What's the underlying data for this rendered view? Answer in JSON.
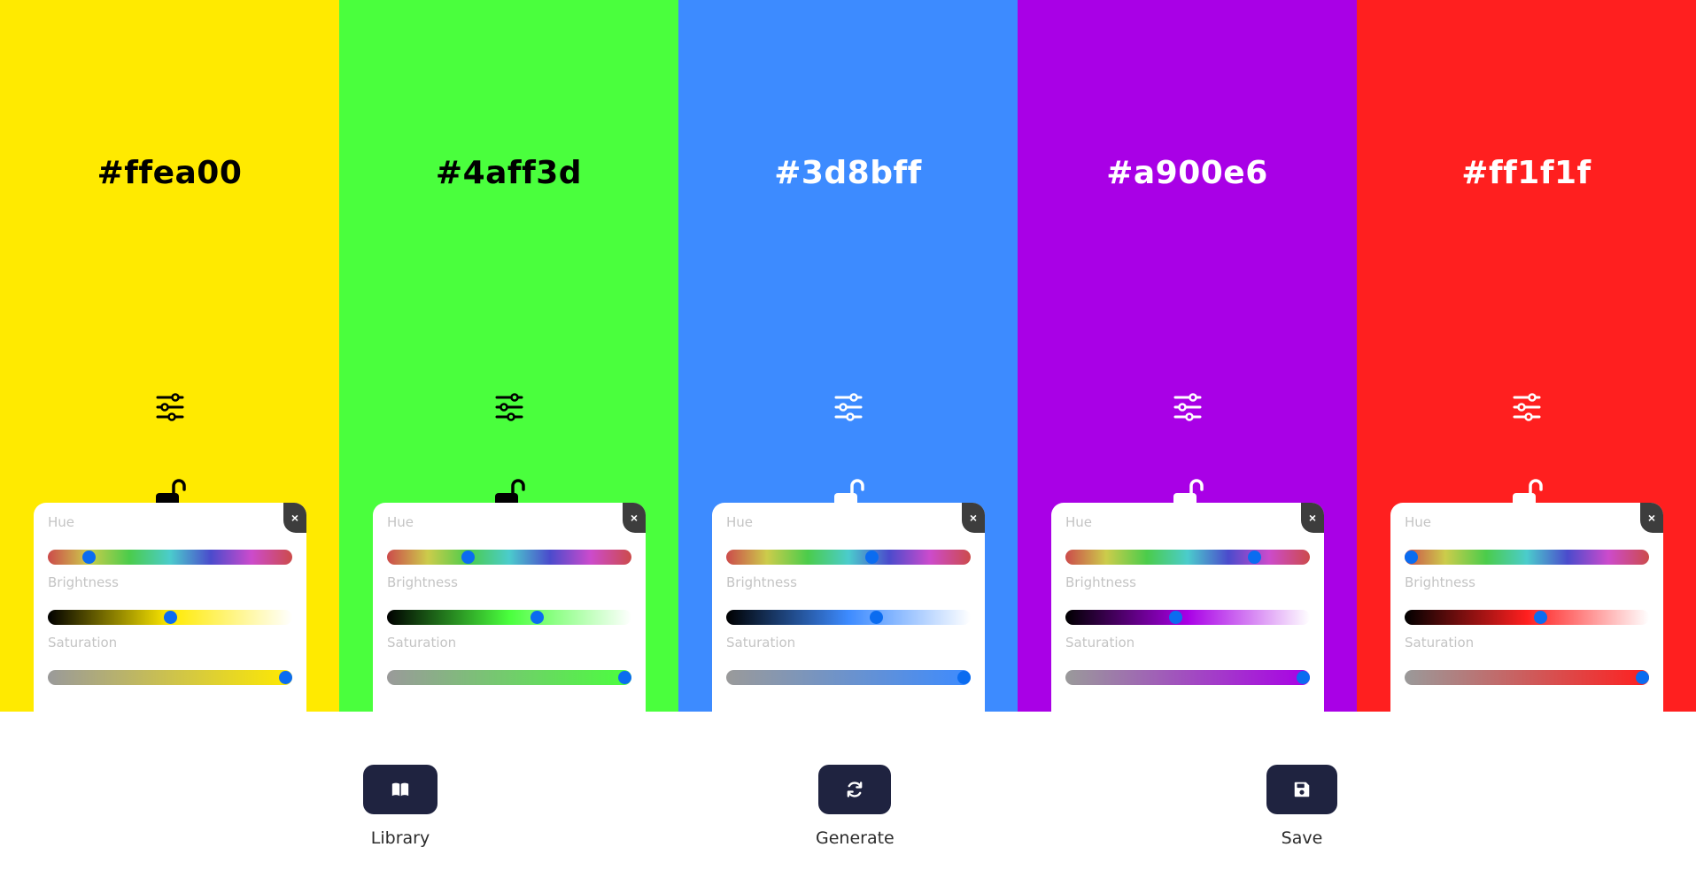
{
  "colors": [
    {
      "hex": "#ffea00",
      "text_color": "#000000",
      "sliders": {
        "hue": {
          "label": "Hue",
          "value": 54
        },
        "brightness": {
          "label": "Brightness",
          "value": 0.5
        },
        "saturation": {
          "label": "Saturation",
          "value": 1.0
        }
      },
      "close_label": "×"
    },
    {
      "hex": "#4aff3d",
      "text_color": "#000000",
      "sliders": {
        "hue": {
          "label": "Hue",
          "value": 116
        },
        "brightness": {
          "label": "Brightness",
          "value": 0.62
        },
        "saturation": {
          "label": "Saturation",
          "value": 1.0
        }
      },
      "close_label": "×"
    },
    {
      "hex": "#3d8bff",
      "text_color": "#ffffff",
      "sliders": {
        "hue": {
          "label": "Hue",
          "value": 216
        },
        "brightness": {
          "label": "Brightness",
          "value": 0.62
        },
        "saturation": {
          "label": "Saturation",
          "value": 1.0
        }
      },
      "close_label": "×"
    },
    {
      "hex": "#a900e6",
      "text_color": "#ffffff",
      "sliders": {
        "hue": {
          "label": "Hue",
          "value": 284
        },
        "brightness": {
          "label": "Brightness",
          "value": 0.45
        },
        "saturation": {
          "label": "Saturation",
          "value": 1.0
        }
      },
      "close_label": "×"
    },
    {
      "hex": "#ff1f1f",
      "text_color": "#ffffff",
      "sliders": {
        "hue": {
          "label": "Hue",
          "value": 0
        },
        "brightness": {
          "label": "Brightness",
          "value": 0.56
        },
        "saturation": {
          "label": "Saturation",
          "value": 1.0
        }
      },
      "close_label": "×"
    }
  ],
  "icons": {
    "adjust": "sliders-icon",
    "lock": "unlocked-padlock-icon",
    "close": "close-icon",
    "library": "book-icon",
    "generate": "refresh-icon",
    "save": "floppy-disk-icon"
  },
  "controls": {
    "library": {
      "label": "Library"
    },
    "generate": {
      "label": "Generate"
    },
    "save": {
      "label": "Save"
    }
  },
  "theme": {
    "control_button_bg": "#1f2340",
    "slider_thumb": "#0b6cf0",
    "close_button_bg": "#3d3d3d",
    "slider_label_color": "#c4c4c4"
  }
}
